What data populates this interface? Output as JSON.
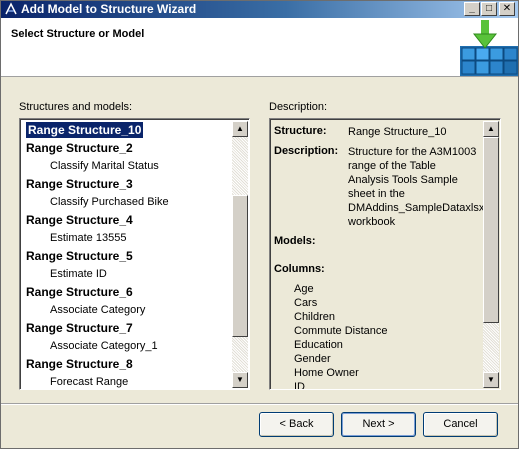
{
  "window": {
    "title": "Add Model to Structure Wizard",
    "controls": {
      "minimize": "_",
      "maximize": "□",
      "close": "✕"
    }
  },
  "header": {
    "title": "Select Structure or Model",
    "graphic_icon": "cube-with-down-arrow-icon"
  },
  "left_panel": {
    "label": "Structures and models:",
    "items": [
      {
        "type": "structure",
        "label": "Range Structure_10",
        "selected": true
      },
      {
        "type": "structure",
        "label": "Range Structure_2"
      },
      {
        "type": "model",
        "label": "Classify Marital Status"
      },
      {
        "type": "structure",
        "label": "Range Structure_3"
      },
      {
        "type": "model",
        "label": "Classify Purchased Bike"
      },
      {
        "type": "structure",
        "label": "Range Structure_4"
      },
      {
        "type": "model",
        "label": "Estimate 13555"
      },
      {
        "type": "structure",
        "label": "Range Structure_5"
      },
      {
        "type": "model",
        "label": "Estimate ID"
      },
      {
        "type": "structure",
        "label": "Range Structure_6"
      },
      {
        "type": "model",
        "label": "Associate Category"
      },
      {
        "type": "structure",
        "label": "Range Structure_7"
      },
      {
        "type": "model",
        "label": "Associate Category_1"
      },
      {
        "type": "structure",
        "label": "Range Structure_8"
      },
      {
        "type": "model",
        "label": "Forecast Range"
      }
    ]
  },
  "right_panel": {
    "label": "Description:",
    "structure_key": "Structure:",
    "structure_value": "Range Structure_10",
    "description_key": "Description:",
    "description_lines": [
      "Structure for the A3M1003",
      "range of the Table",
      "Analysis Tools Sample",
      "sheet in the",
      "DMAddins_SampleDataxlsx",
      "workbook"
    ],
    "models_key": "Models:",
    "columns_key": "Columns:",
    "columns": [
      "Age",
      "Cars",
      "Children",
      "Commute Distance",
      "Education",
      "Gender",
      "Home Owner",
      "ID"
    ]
  },
  "buttons": {
    "back": "< Back",
    "next": "Next >",
    "cancel": "Cancel"
  },
  "colors": {
    "selection": "#0a246a",
    "titlebar_start": "#0a246a",
    "titlebar_end": "#a6caf0",
    "window_bg": "#ece9d8"
  }
}
